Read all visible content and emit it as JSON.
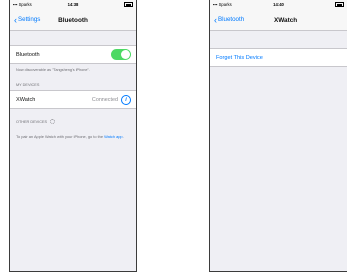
{
  "screen1": {
    "status": {
      "carrier": "Sparks",
      "time": "14:38"
    },
    "nav": {
      "back_label": "Settings",
      "title": "Bluetooth"
    },
    "bluetooth_row": {
      "label": "Bluetooth",
      "toggle_on": true
    },
    "discoverable_text": "Now discoverable as \"Tangsheng's iPhone\".",
    "my_devices_header": "MY DEVICES",
    "device": {
      "name": "XWatch",
      "status": "Connected"
    },
    "other_devices_header": "OTHER DEVICES",
    "footer_text": "To pair an Apple Watch with your iPhone, go to the",
    "footer_link": "Watch app",
    "footer_end": "."
  },
  "screen2": {
    "status": {
      "carrier": "Sparks",
      "time": "14:40"
    },
    "nav": {
      "back_label": "Bluetooth",
      "title": "XWatch"
    },
    "forget_label": "Forget This Device"
  },
  "colors": {
    "accent": "#007aff",
    "toggle_on": "#4cd964",
    "background": "#efeff4"
  },
  "icons": [
    "chevron-left-icon",
    "info-icon",
    "spinner-icon",
    "battery-icon",
    "signal-icon"
  ]
}
